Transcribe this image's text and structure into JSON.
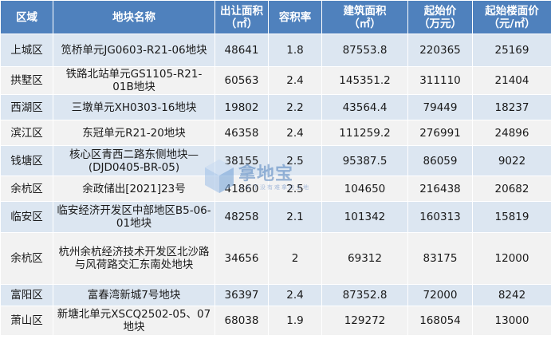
{
  "table": {
    "headers": [
      "区域",
      "地块名称",
      "出让面积\n（㎡）",
      "容积率",
      "建筑面积\n（㎡）",
      "起始价\n（万元）",
      "起始楼面价\n（元/㎡）"
    ],
    "rows": [
      [
        "上城区",
        "笕桥单元JG0603-R21-06地块",
        "48641",
        "1.8",
        "87553.8",
        "220365",
        "25169"
      ],
      [
        "拱墅区",
        "铁路北站单元GS1105-R21-01B地块",
        "60563",
        "2.4",
        "145351.2",
        "311110",
        "21404"
      ],
      [
        "西湖区",
        "三墩单元XH0303-16地块",
        "19802",
        "2.2",
        "43564.4",
        "79449",
        "18237"
      ],
      [
        "滨江区",
        "东冠单元R21-20地块",
        "46358",
        "2.4",
        "111259.2",
        "276991",
        "24896"
      ],
      [
        "钱塘区",
        "核心区青西二路东侧地块—(DJD0405-BR-05)",
        "38155",
        "2.5",
        "95387.5",
        "86059",
        "9022"
      ],
      [
        "余杭区",
        "余政储出[2021]23号",
        "41860",
        "2.5",
        "104650",
        "216438",
        "20682"
      ],
      [
        "临安区",
        "临安经济开发区中部地区B5-06-01地块",
        "48258",
        "2.1",
        "101342",
        "160313",
        "15819"
      ],
      [
        "余杭区",
        "杭州余杭经济技术开发区北沙路与风荷路交汇东南处地块",
        "34656",
        "2",
        "69312",
        "83175",
        "12000"
      ],
      [
        "富阳区",
        "富春湾新城7号地块",
        "36397",
        "2.4",
        "87352.8",
        "72000",
        "8242"
      ],
      [
        "萧山区",
        "新塘北单元XSCQ2502-05、07地块",
        "68038",
        "1.9",
        "129272",
        "168054",
        "13000"
      ]
    ]
  },
  "watermark": {
    "text": "拿地宝",
    "subtitle": "让天下没有难拿的土地"
  }
}
